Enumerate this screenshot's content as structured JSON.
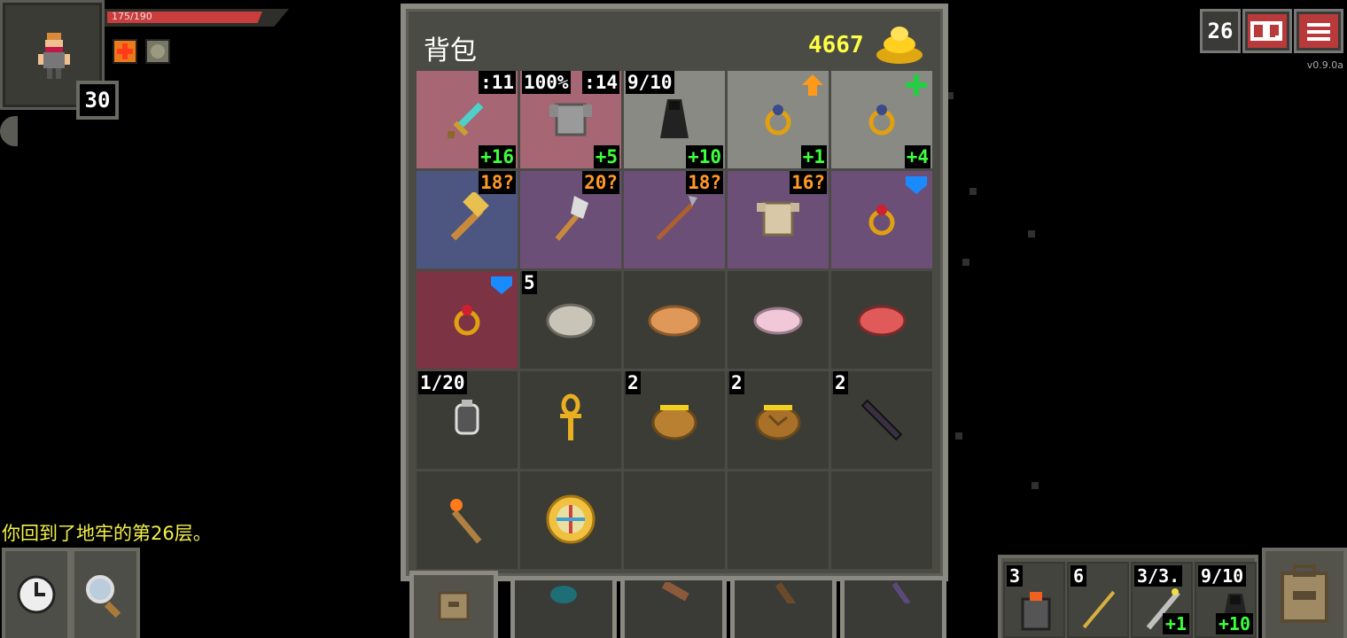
{
  "hero": {
    "hp_text": "175/190",
    "hp_current": 175,
    "hp_max": 190,
    "level": "30",
    "buffs": [
      "fire-buff-icon",
      "shield-buff-icon"
    ]
  },
  "log": {
    "message": "你回到了地牢的第26层。"
  },
  "top_right": {
    "depth": "26",
    "version": "v0.9.0a"
  },
  "inventory": {
    "title": "背包",
    "gold": "4667",
    "rows": [
      [
        {
          "icon": "diamond-sword-icon",
          "tl": "",
          "tr": ":11",
          "br": "+16",
          "bg": "equip-red"
        },
        {
          "icon": "plate-armor-icon",
          "tl": "100%",
          "tr": ":14",
          "br": "+5",
          "bg": "equip-red"
        },
        {
          "icon": "cloak-icon",
          "tl": "9/10",
          "tr": "",
          "br": "+10",
          "bg": "equip-grey"
        },
        {
          "icon": "ring-icon",
          "tl": "",
          "tr": "",
          "br": "+1",
          "bg": "equip-grey",
          "mark": "upgrade-arrow-icon"
        },
        {
          "icon": "ring-icon",
          "tl": "",
          "tr": "",
          "br": "+4",
          "bg": "equip-grey",
          "mark": "plus-green-icon"
        }
      ],
      [
        {
          "icon": "war-hammer-icon",
          "tl": "",
          "tr": "18?",
          "br": "",
          "bg": "curse-blue"
        },
        {
          "icon": "battle-axe-icon",
          "tl": "",
          "tr": "20?",
          "br": "",
          "bg": "curse-purple"
        },
        {
          "icon": "spear-icon",
          "tl": "",
          "tr": "18?",
          "br": "",
          "bg": "curse-purple"
        },
        {
          "icon": "leather-armor-icon",
          "tl": "",
          "tr": "16?",
          "br": "",
          "bg": "curse-purple"
        },
        {
          "icon": "ruby-ring-icon",
          "tl": "",
          "tr": "",
          "br": "",
          "bg": "curse-purple",
          "mark": "blue-shield-icon"
        }
      ],
      [
        {
          "icon": "ruby-ring-icon",
          "tl": "",
          "tr": "",
          "br": "",
          "bg": "curse-red",
          "mark": "blue-shield-icon"
        },
        {
          "icon": "stone-icon",
          "tl": "5",
          "tr": "",
          "br": "",
          "bg": ""
        },
        {
          "icon": "pasty-icon",
          "tl": "",
          "tr": "",
          "br": "",
          "bg": ""
        },
        {
          "icon": "feather-icon",
          "tl": "",
          "tr": "",
          "br": "",
          "bg": ""
        },
        {
          "icon": "meat-icon",
          "tl": "",
          "tr": "",
          "br": "",
          "bg": ""
        }
      ],
      [
        {
          "icon": "dew-vial-icon",
          "tl": "1/20",
          "tr": "",
          "br": "",
          "bg": ""
        },
        {
          "icon": "ankh-icon",
          "tl": "",
          "tr": "",
          "br": "",
          "bg": ""
        },
        {
          "icon": "honey-pot-icon",
          "tl": "2",
          "tr": "",
          "br": "",
          "bg": ""
        },
        {
          "icon": "cracked-honey-pot-icon",
          "tl": "2",
          "tr": "",
          "br": "",
          "bg": ""
        },
        {
          "icon": "dark-wand-icon",
          "tl": "2",
          "tr": "",
          "br": "",
          "bg": ""
        }
      ],
      [
        {
          "icon": "torch-icon",
          "tl": "",
          "tr": "",
          "br": "",
          "bg": ""
        },
        {
          "icon": "golden-compass-icon",
          "tl": "",
          "tr": "",
          "br": "",
          "bg": ""
        },
        {
          "icon": "",
          "tl": "",
          "tr": "",
          "br": "",
          "bg": ""
        },
        {
          "icon": "",
          "tl": "",
          "tr": "",
          "br": "",
          "bg": ""
        },
        {
          "icon": "",
          "tl": "",
          "tr": "",
          "br": "",
          "bg": ""
        }
      ]
    ]
  },
  "quickslots": [
    {
      "icon": "brazier-icon",
      "count": "3",
      "bonus": ""
    },
    {
      "icon": "dart-icon",
      "count": "6",
      "bonus": ""
    },
    {
      "icon": "wand-icon",
      "count": "3/3.",
      "bonus": "+1"
    },
    {
      "icon": "cloak-icon",
      "count": "9/10",
      "bonus": "+10"
    }
  ],
  "colors": {
    "hp": "#c93d3d",
    "gold": "#ffff44",
    "bonus_green": "#3dff3d",
    "unknown_orange": "#ff9a28",
    "log_yellow": "#f2f04a"
  }
}
